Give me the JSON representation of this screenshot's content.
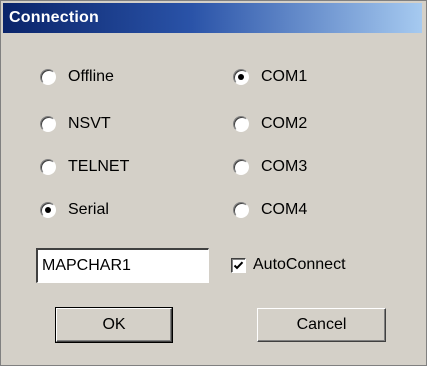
{
  "window": {
    "title": "Connection"
  },
  "connection_type": {
    "options": [
      {
        "label": "Offline",
        "selected": false
      },
      {
        "label": "NSVT",
        "selected": false
      },
      {
        "label": "TELNET",
        "selected": false
      },
      {
        "label": "Serial",
        "selected": true
      }
    ]
  },
  "com_port": {
    "options": [
      {
        "label": "COM1",
        "selected": true
      },
      {
        "label": "COM2",
        "selected": false
      },
      {
        "label": "COM3",
        "selected": false
      },
      {
        "label": "COM4",
        "selected": false
      }
    ]
  },
  "host_field": {
    "value": "MAPCHAR1"
  },
  "autoconnect": {
    "label": "AutoConnect",
    "checked": true
  },
  "buttons": {
    "ok_label": "OK",
    "cancel_label": "Cancel"
  },
  "colors": {
    "title_bar_start": "#0a246a",
    "title_bar_end": "#a6caf0",
    "dialog_face": "#d4d0c8"
  }
}
